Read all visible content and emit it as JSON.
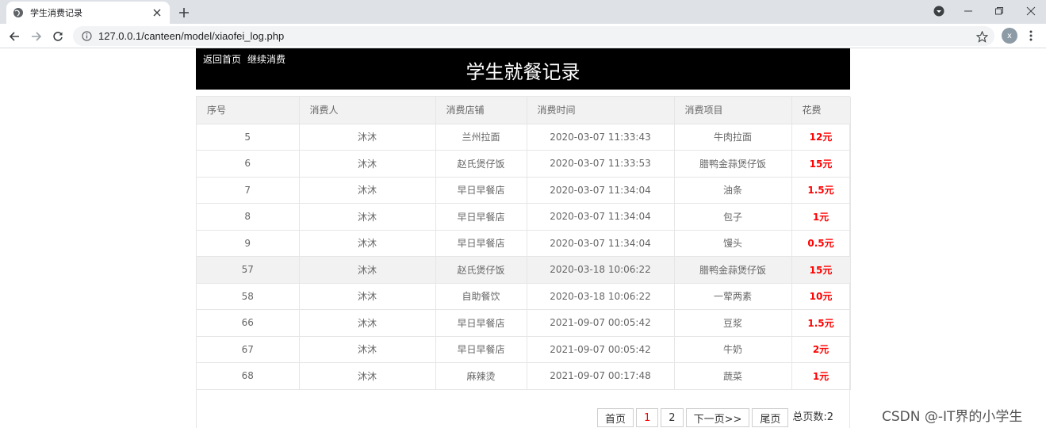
{
  "browser": {
    "tab_title": "学生消费记录",
    "url": "127.0.0.1/canteen/model/xiaofei_log.php",
    "avatar_letter": "x"
  },
  "header": {
    "links": [
      "返回首页",
      "继续消费"
    ],
    "title": "学生就餐记录"
  },
  "table": {
    "columns": [
      "序号",
      "消费人",
      "消费店铺",
      "消费时间",
      "消费项目",
      "花费"
    ],
    "rows": [
      [
        "5",
        "沐沐",
        "兰州拉面",
        "2020-03-07 11:33:43",
        "牛肉拉面",
        "12元"
      ],
      [
        "6",
        "沐沐",
        "赵氏煲仔饭",
        "2020-03-07 11:33:53",
        "腊鸭金蒜煲仔饭",
        "15元"
      ],
      [
        "7",
        "沐沐",
        "早日早餐店",
        "2020-03-07 11:34:04",
        "油条",
        "1.5元"
      ],
      [
        "8",
        "沐沐",
        "早日早餐店",
        "2020-03-07 11:34:04",
        "包子",
        "1元"
      ],
      [
        "9",
        "沐沐",
        "早日早餐店",
        "2020-03-07 11:34:04",
        "馒头",
        "0.5元"
      ],
      [
        "57",
        "沐沐",
        "赵氏煲仔饭",
        "2020-03-18 10:06:22",
        "腊鸭金蒜煲仔饭",
        "15元"
      ],
      [
        "58",
        "沐沐",
        "自助餐饮",
        "2020-03-18 10:06:22",
        "一荤两素",
        "10元"
      ],
      [
        "66",
        "沐沐",
        "早日早餐店",
        "2021-09-07 00:05:42",
        "豆浆",
        "1.5元"
      ],
      [
        "67",
        "沐沐",
        "早日早餐店",
        "2021-09-07 00:05:42",
        "牛奶",
        "2元"
      ],
      [
        "68",
        "沐沐",
        "麻辣烫",
        "2021-09-07 00:17:48",
        "蔬菜",
        "1元"
      ]
    ],
    "highlighted_row": 5
  },
  "pager": {
    "first": "首页",
    "pages": [
      "1",
      "2"
    ],
    "current": "1",
    "next": "下一页>>",
    "last": "尾页",
    "total": "总页数:2"
  },
  "watermark": "CSDN @-IT界的小学生",
  "colors": {
    "header_bg": "#000000",
    "cost": "#ff0000",
    "table_header_bg": "#f2f2f2"
  }
}
